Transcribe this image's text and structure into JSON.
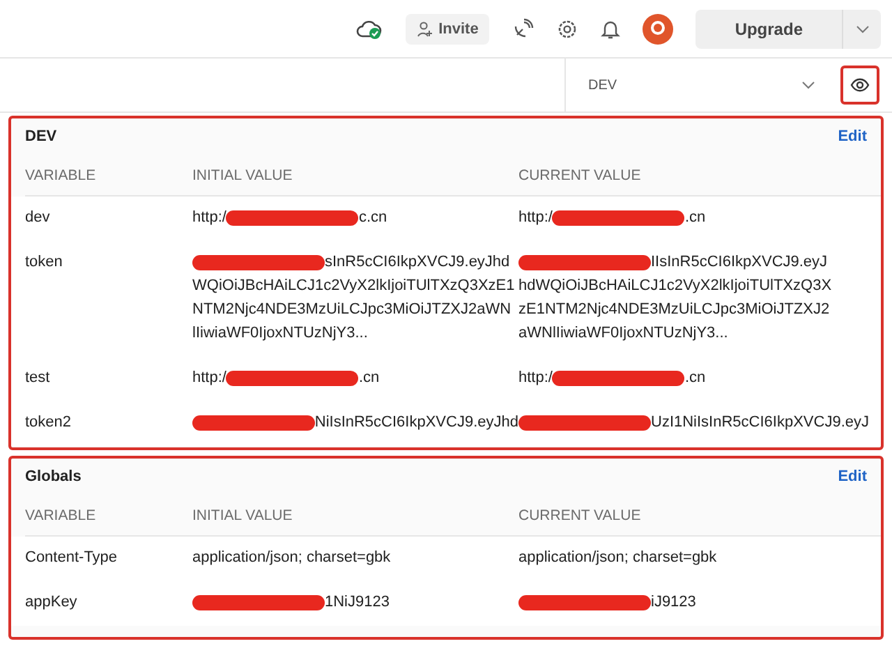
{
  "topbar": {
    "invite": "Invite",
    "upgrade": "Upgrade"
  },
  "env_bar": {
    "environment": "DEV",
    "eye_highlighted": true
  },
  "sections": [
    {
      "title": "DEV",
      "edit": "Edit",
      "highlighted": true,
      "columns": [
        "VARIABLE",
        "INITIAL VALUE",
        "CURRENT VALUE"
      ],
      "rows": [
        {
          "variable": "dev",
          "initial": {
            "prefix": "http:/",
            "redacted": true,
            "lines": [
              "c.cn"
            ]
          },
          "current": {
            "prefix": "http:/",
            "redacted": true,
            "lines": [
              ".cn"
            ]
          }
        },
        {
          "variable": "token",
          "initial": {
            "redacted": true,
            "lines": [
              "sInR5cCI6IkpXVCJ9.eyJhd",
              "WQiOiJBcHAiLCJ1c2VyX2lkIjoiTUlTXzQ3XzE1",
              "NTM2Njc4NDE3MzUiLCJpc3MiOiJTZXJ2aWN",
              "lIiwiaWF0IjoxNTUzNjY3..."
            ]
          },
          "current": {
            "redacted": true,
            "lines": [
              "IIsInR5cCI6IkpXVCJ9.eyJ",
              "hdWQiOiJBcHAiLCJ1c2VyX2lkIjoiTUlTXzQ3X",
              "zE1NTM2Njc4NDE3MzUiLCJpc3MiOiJTZXJ2",
              "aWNlIiwiaWF0IjoxNTUzNjY3..."
            ]
          }
        },
        {
          "variable": "test",
          "initial": {
            "prefix": "http:/",
            "redacted": true,
            "lines": [
              ".cn"
            ]
          },
          "current": {
            "prefix": "http:/",
            "redacted": true,
            "lines": [
              ".cn"
            ]
          }
        },
        {
          "variable": "token2",
          "initial": {
            "redacted": true,
            "lines": [
              "NiIsInR5cCI6IkpXVCJ9.eyJhd"
            ]
          },
          "current": {
            "redacted": true,
            "lines": [
              "UzI1NiIsInR5cCI6IkpXVCJ9.eyJ"
            ]
          }
        }
      ]
    },
    {
      "title": "Globals",
      "edit": "Edit",
      "highlighted": true,
      "columns": [
        "VARIABLE",
        "INITIAL VALUE",
        "CURRENT VALUE"
      ],
      "rows": [
        {
          "variable": "Content-Type",
          "initial": {
            "redacted": false,
            "lines": [
              "application/json; charset=gbk"
            ]
          },
          "current": {
            "redacted": false,
            "lines": [
              "application/json; charset=gbk"
            ]
          }
        },
        {
          "variable": "appKey",
          "initial": {
            "redacted": true,
            "lines": [
              "1NiJ9123"
            ]
          },
          "current": {
            "redacted": true,
            "lines": [
              "iJ9123"
            ]
          }
        }
      ]
    }
  ]
}
